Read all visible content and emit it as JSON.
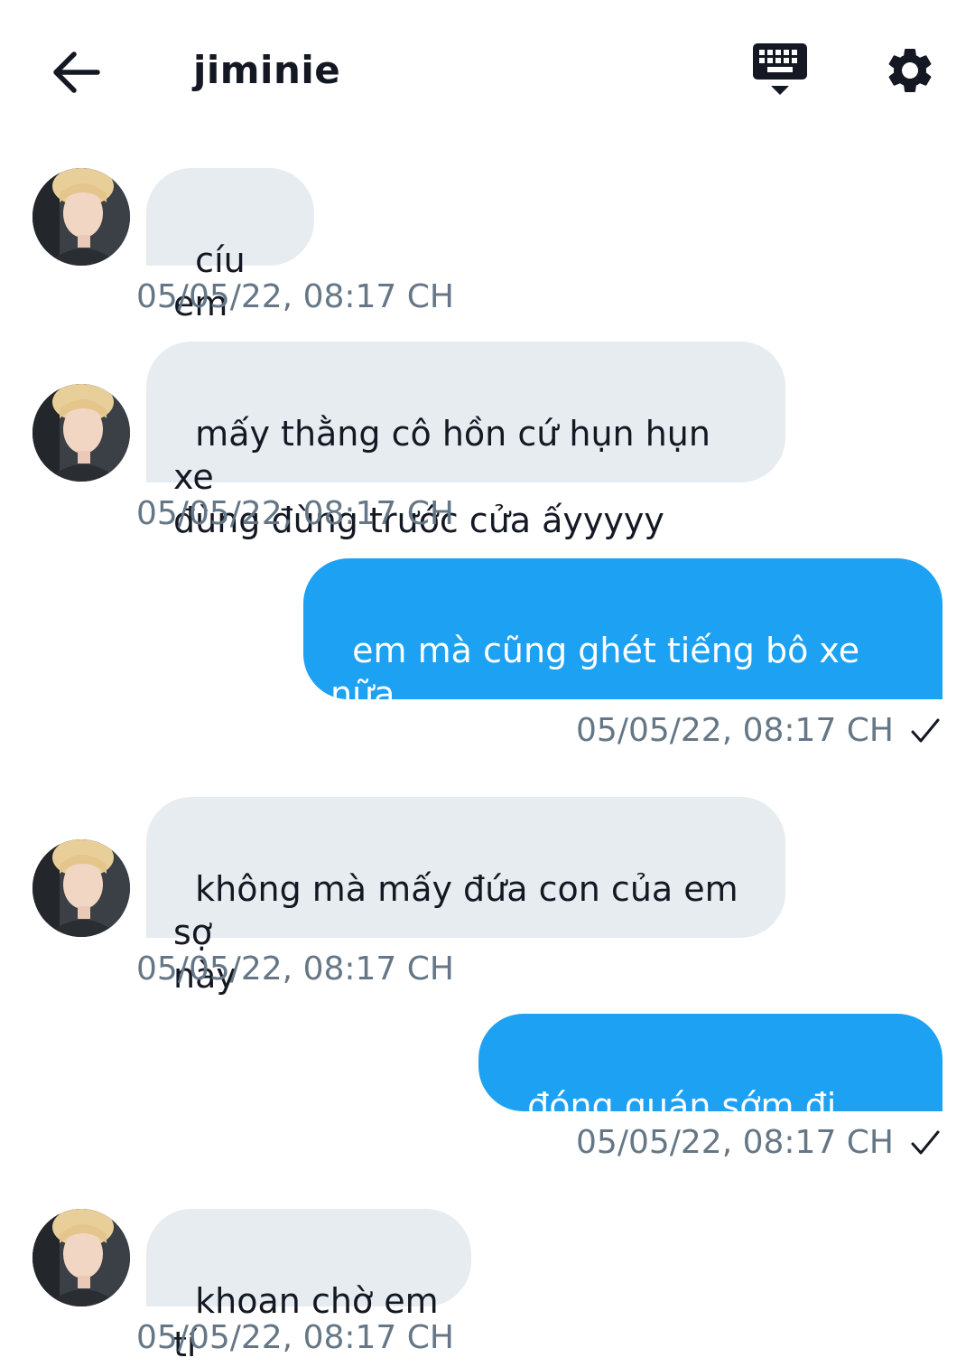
{
  "header": {
    "title": "jiminie",
    "back_icon": "arrow-left-icon",
    "keyboard_icon": "keyboard-hide-icon",
    "settings_icon": "gear-icon"
  },
  "colors": {
    "incoming_bubble": "#e6ecf0",
    "outgoing_bubble": "#1da1f2",
    "timestamp": "#657786"
  },
  "messages": [
    {
      "direction": "incoming",
      "text": "cíu em",
      "time": "05/05/22, 08:17 CH"
    },
    {
      "direction": "incoming",
      "text": "mấy thằng cô hồn cứ hụn hụn xe\nđùng đùng trước cửa ấyyyyy",
      "time": "05/05/22, 08:17 CH"
    },
    {
      "direction": "outgoing",
      "text": "em mà cũng ghét tiếng bô xe nữa\nhả?",
      "time": "05/05/22, 08:17 CH"
    },
    {
      "direction": "incoming",
      "text": "không mà mấy đứa con của em sợ\nnày",
      "time": "05/05/22, 08:17 CH"
    },
    {
      "direction": "outgoing",
      "text": "đóng quán sớm đi Jimin",
      "time": "05/05/22, 08:17 CH"
    },
    {
      "direction": "incoming",
      "text": "khoan chờ em tí",
      "time": "05/05/22, 08:17 CH"
    }
  ]
}
